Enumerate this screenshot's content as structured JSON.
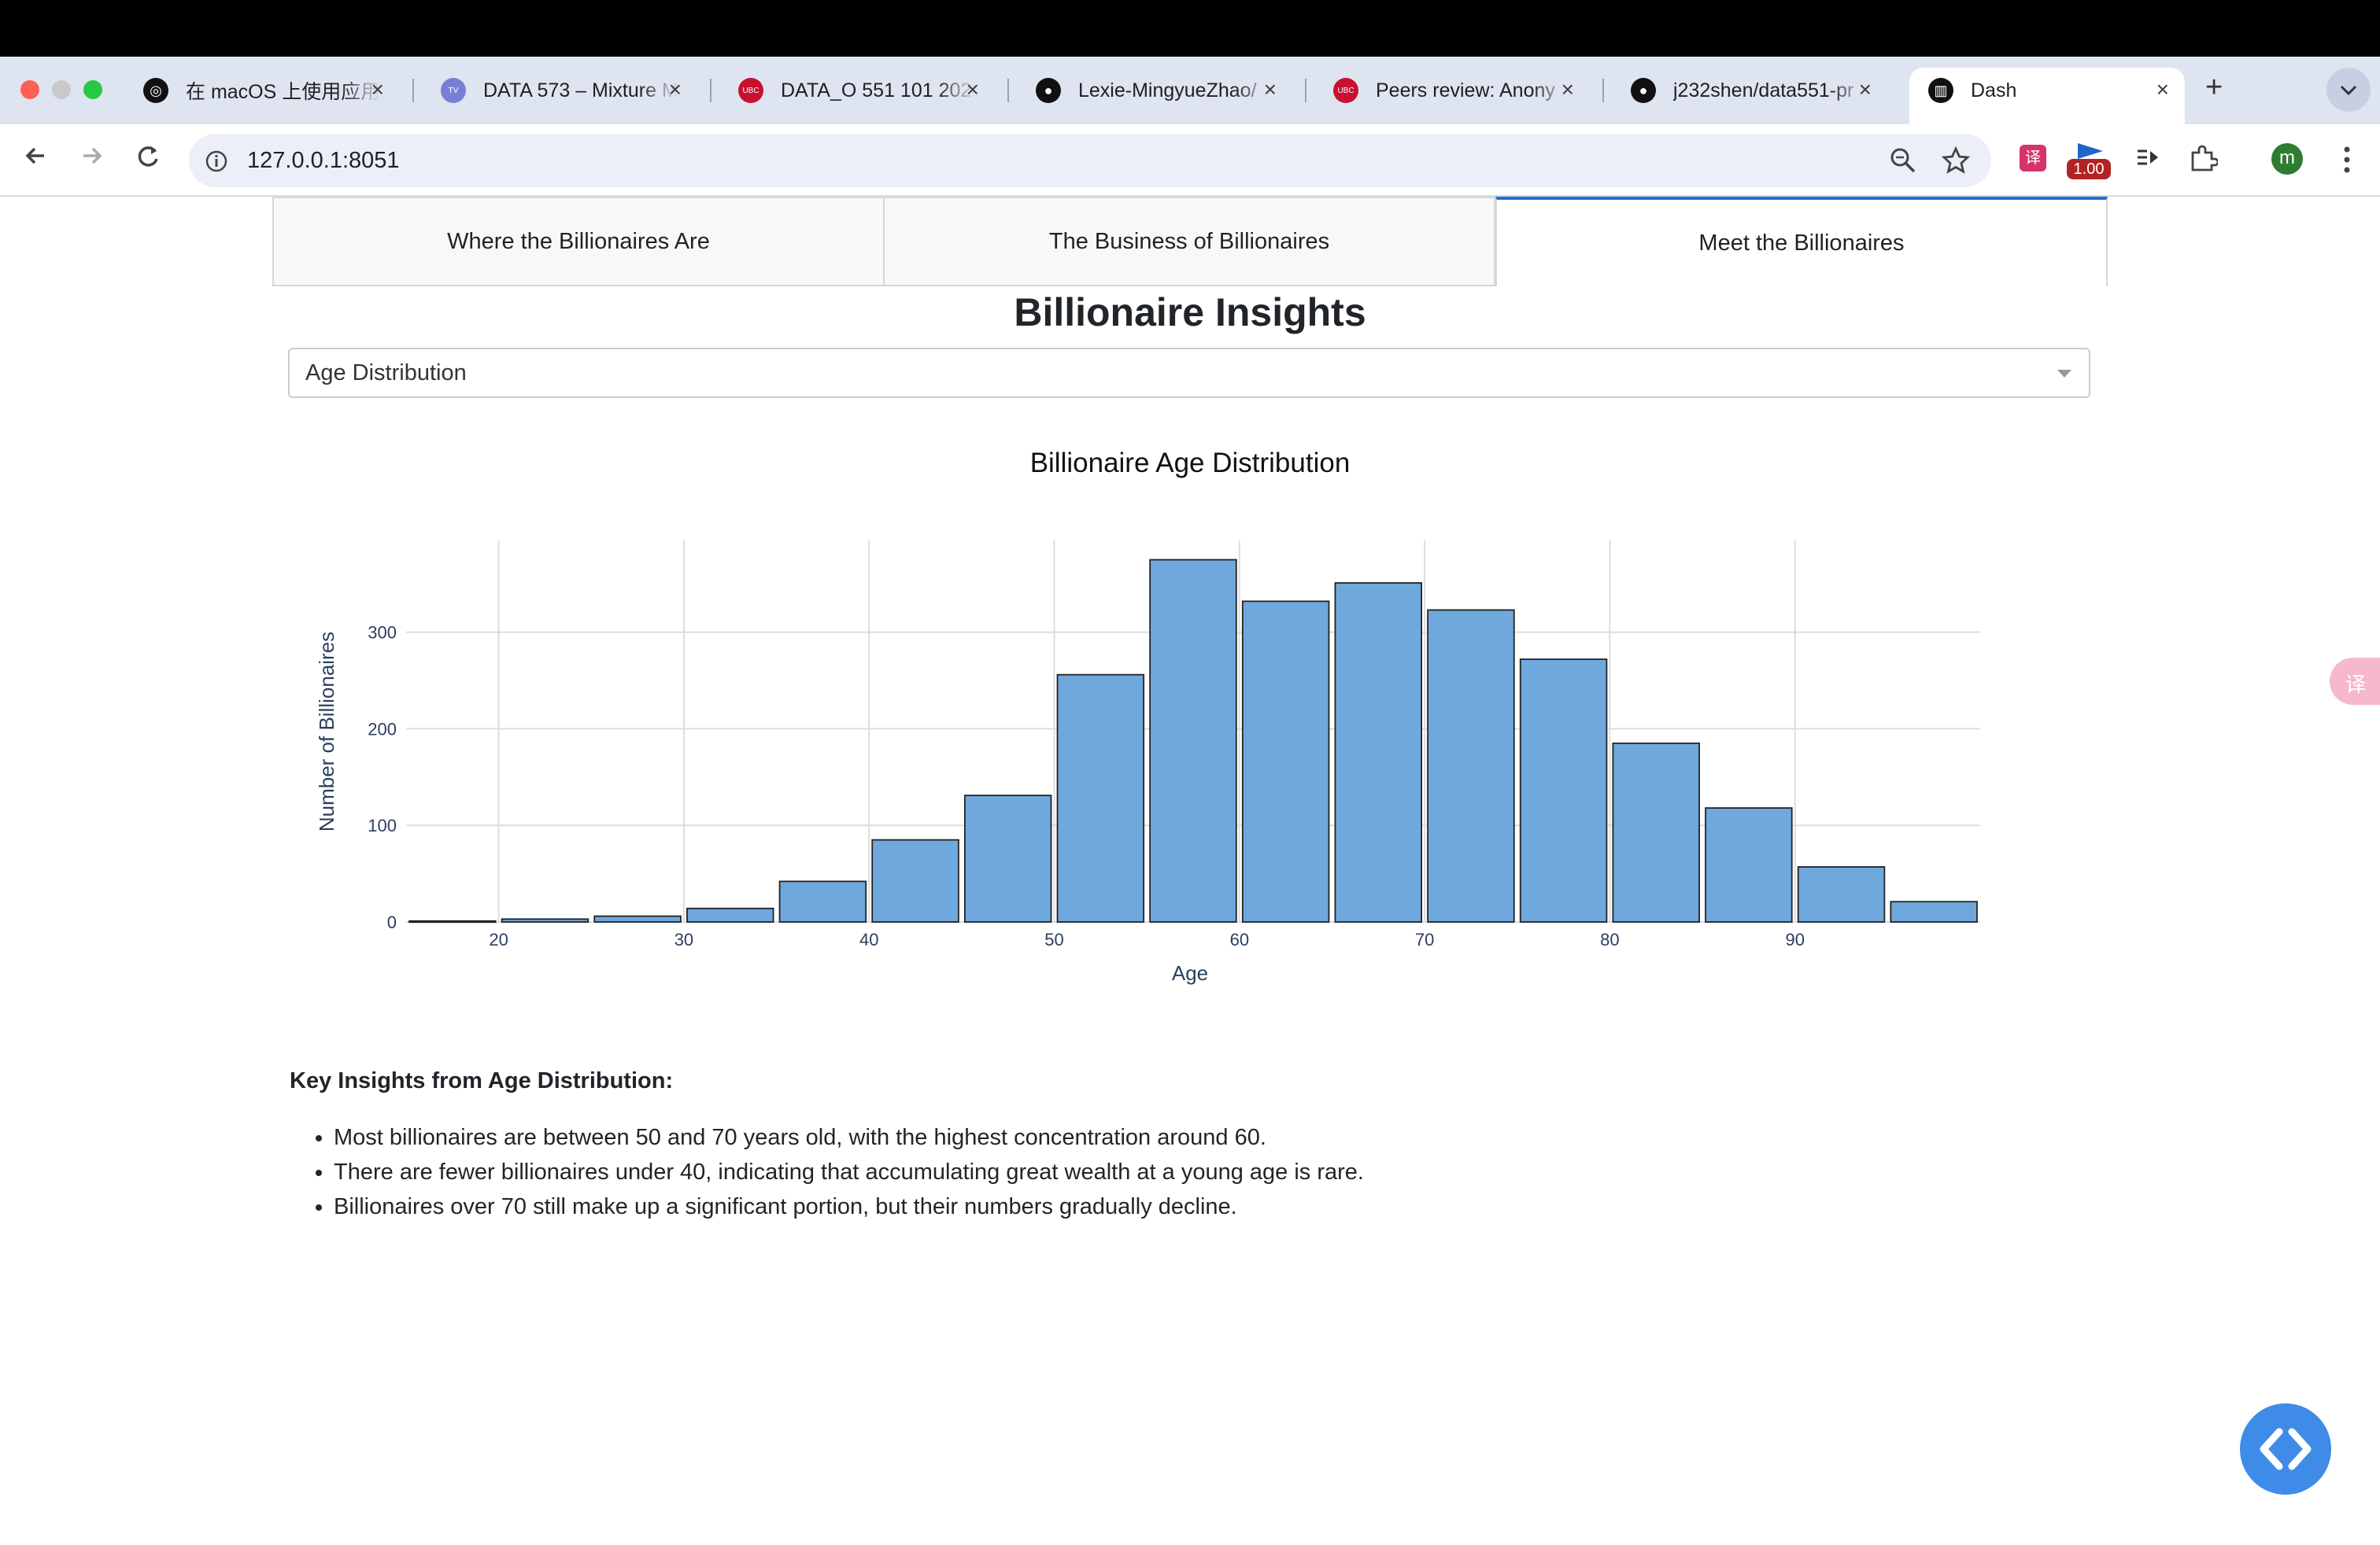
{
  "browser": {
    "tabs": [
      {
        "title": "在 macOS 上使用应用",
        "favicon": "openai-icon"
      },
      {
        "title": "DATA 573 – Mixture M",
        "favicon": "tv-icon"
      },
      {
        "title": "DATA_O 551 101 2024",
        "favicon": "ubc-icon"
      },
      {
        "title": "Lexie-MingyueZhao/",
        "favicon": "github-icon"
      },
      {
        "title": "Peers review: Anony",
        "favicon": "ubc-icon"
      },
      {
        "title": "j232shen/data551-pr",
        "favicon": "github-icon"
      },
      {
        "title": "Dash",
        "favicon": "dash-icon",
        "active": true
      }
    ],
    "address": "127.0.0.1:8051",
    "extension_badge": "1.00",
    "profile_initial": "m"
  },
  "page": {
    "nav_tabs": [
      {
        "label": "Where the Billionaires Are",
        "active": false
      },
      {
        "label": "The Business of Billionaires",
        "active": false
      },
      {
        "label": "Meet the Billionaires",
        "active": true
      }
    ],
    "title": "Billionaire Insights",
    "dropdown": {
      "selected": "Age Distribution"
    },
    "insights_title": "Key Insights from Age Distribution:",
    "insights": [
      "Most billionaires are between 50 and 70 years old, with the highest concentration around 60.",
      "There are fewer billionaires under 40, indicating that accumulating great wealth at a young age is rare.",
      "Billionaires over 70 still make up a significant portion, but their numbers gradually decline."
    ]
  },
  "chart_data": {
    "type": "bar",
    "title": "Billionaire Age Distribution",
    "xlabel": "Age",
    "ylabel": "Number of Billionaires",
    "bin_width": 5,
    "bin_starts": [
      15,
      20,
      25,
      30,
      35,
      40,
      45,
      50,
      55,
      60,
      65,
      70,
      75,
      80,
      85,
      90,
      95
    ],
    "values": [
      1,
      3,
      6,
      14,
      42,
      85,
      131,
      256,
      375,
      332,
      351,
      323,
      272,
      185,
      118,
      57,
      21
    ],
    "xlim": [
      15,
      100
    ],
    "ylim": [
      0,
      395
    ],
    "x_ticks": [
      20,
      30,
      40,
      50,
      60,
      70,
      80,
      90
    ],
    "y_ticks": [
      0,
      100,
      200,
      300
    ],
    "grid": true,
    "bar_color": "#6fa8dc",
    "bar_edge_color": "#222222"
  },
  "colors": {
    "accent": "#1f6fd6",
    "fab": "#3f8be8"
  }
}
